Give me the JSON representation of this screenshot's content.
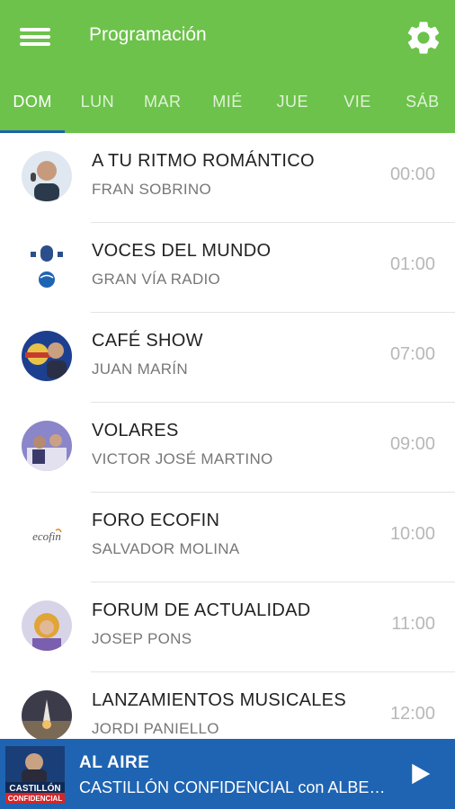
{
  "header": {
    "title": "Programación",
    "menu_icon": "menu-icon",
    "settings_icon": "gear-icon"
  },
  "tabs": [
    {
      "label": "DOM",
      "active": true
    },
    {
      "label": "LUN",
      "active": false
    },
    {
      "label": "MAR",
      "active": false
    },
    {
      "label": "MIÉ",
      "active": false
    },
    {
      "label": "JUE",
      "active": false
    },
    {
      "label": "VIE",
      "active": false
    },
    {
      "label": "SÁB",
      "active": false
    }
  ],
  "programs": [
    {
      "title": "A TU RITMO ROMÁNTICO",
      "host": "FRAN SOBRINO",
      "time": "00:00"
    },
    {
      "title": "VOCES DEL MUNDO",
      "host": "GRAN VÍA RADIO",
      "time": "01:00"
    },
    {
      "title": "CAFÉ SHOW",
      "host": "JUAN MARÍN",
      "time": "07:00"
    },
    {
      "title": "VOLARES",
      "host": "VICTOR JOSÉ MARTINO",
      "time": "09:00"
    },
    {
      "title": "FORO ECOFIN",
      "host": "SALVADOR MOLINA",
      "time": "10:00"
    },
    {
      "title": "FORUM DE ACTUALIDAD",
      "host": "JOSEP PONS",
      "time": "11:00"
    },
    {
      "title": "LANZAMIENTOS MUSICALES",
      "host": "JORDI PANIELLO",
      "time": "12:00"
    }
  ],
  "player": {
    "status": "AL AIRE",
    "now_playing": "CASTILLÓN CONFIDENCIAL con ALBERTO CASTILLÓN",
    "thumb_text_1": "CASTILLÓN",
    "thumb_text_2": "CONFIDENCIAL",
    "play_icon": "play-icon"
  },
  "logos": {
    "ecofin": "ecofin",
    "voces": "VOCES DEL MUNDO"
  },
  "colors": {
    "appbar": "#6cc24a",
    "player": "#1f64b2",
    "tab_indicator": "#1e63b0"
  }
}
